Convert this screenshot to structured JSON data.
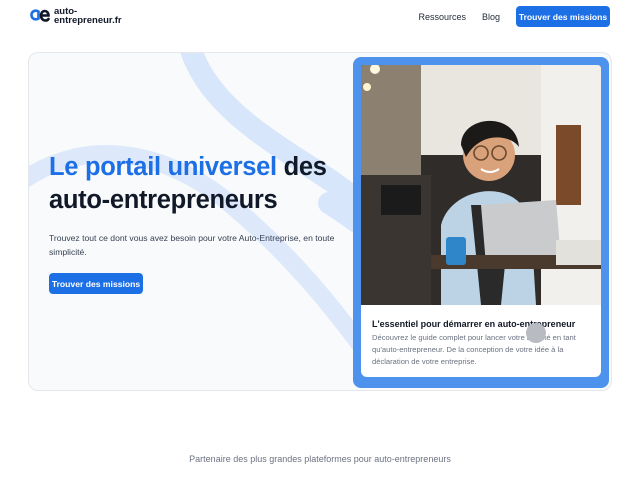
{
  "header": {
    "logo_text_line1": "auto-",
    "logo_text_line2": "entrepreneur.fr",
    "nav": [
      {
        "label": "Ressources"
      },
      {
        "label": "Blog"
      }
    ],
    "cta_label": "Trouver des missions"
  },
  "hero": {
    "title_accent": "Le portail universel",
    "title_rest_1": " des",
    "title_rest_2": "auto-entrepreneurs",
    "description": "Trouvez tout ce dont vous avez besoin pour votre Auto-Entreprise, en toute simplicité.",
    "cta_label": "Trouver des missions"
  },
  "feature_card": {
    "title": "L'essentiel pour démarrer en auto-entrepreneur",
    "description": "Découvrez le guide complet pour lancer votre activité en tant qu'auto-entrepreneur. De la conception de votre idée à la déclaration de votre entreprise."
  },
  "partner_text": "Partenaire des plus grandes plateformes pour auto-entrepreneurs",
  "colors": {
    "accent": "#1d6fe6",
    "card_blue": "#4d93ee",
    "hero_bg": "#f8fafc"
  }
}
